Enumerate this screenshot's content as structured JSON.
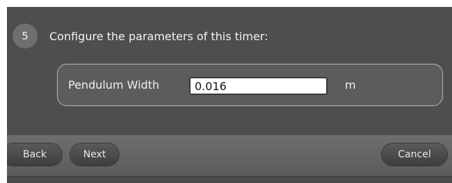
{
  "step": {
    "number": "5",
    "title": "Configure the parameters of this timer:"
  },
  "parameter": {
    "label": "Pendulum Width",
    "value": "0.016",
    "unit": "m"
  },
  "buttons": {
    "back": "Back",
    "next": "Next",
    "cancel": "Cancel"
  }
}
